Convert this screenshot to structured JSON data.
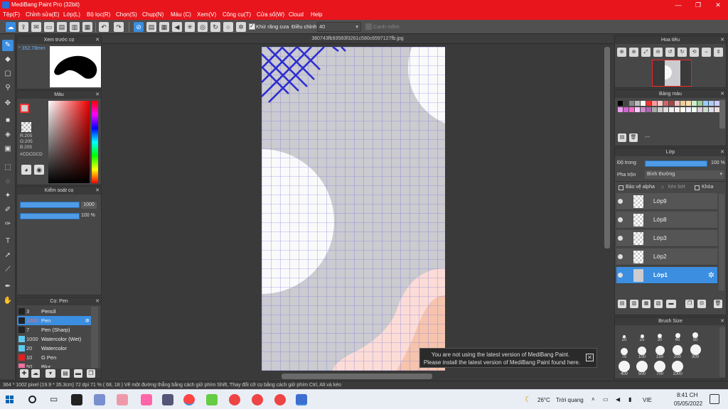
{
  "window": {
    "title": "MediBang Paint Pro (32bit)"
  },
  "menu": [
    "Tệp(F)",
    "Chỉnh sửa(E)",
    "Lớp(L)",
    "Bộ lọc(R)",
    "Chọn(S)",
    "Chụp(N)",
    "Màu (C)",
    "Xem(V)",
    "Công cụ(T)",
    "Cửa sổ(W)",
    "Cloud",
    "Help"
  ],
  "toolbar": {
    "antialias_label": "Khử răng cưa",
    "adjust_label": "Điều chỉnh",
    "adjust_value": "40",
    "edge_label": "Cạnh mềm"
  },
  "preview_panel": {
    "title": "Xem trước cọ",
    "size_text": "352.78mm"
  },
  "color_panel": {
    "title": "Màu",
    "r": "R:205",
    "g": "G:205",
    "b": "B:205",
    "hex": "#CDCDCD"
  },
  "brush_control": {
    "title": "Kiểm soát cọ",
    "size_value": "1000",
    "opacity_value": "100 %",
    "size_fraction": 1.0,
    "opacity_fraction": 1.0
  },
  "brush_panel": {
    "title": "Cọ: Pen",
    "items": [
      {
        "size": "3",
        "name": "Pencil",
        "color": "#222222"
      },
      {
        "size": "1000",
        "name": "Pen",
        "color": "#222222"
      },
      {
        "size": "7",
        "name": "Pen (Sharp)",
        "color": "#222222"
      },
      {
        "size": "1000",
        "name": "Watercolor (Wet)",
        "color": "#5fc8f0"
      },
      {
        "size": "20",
        "name": "Watercolor",
        "color": "#5fc8f0"
      },
      {
        "size": "10",
        "name": "G Pen",
        "color": "#e02020"
      },
      {
        "size": "50",
        "name": "Blur",
        "color": "#f06fa0"
      }
    ]
  },
  "document": {
    "tab_title": "380743fb93583f3261c580c6597127fb.jpg"
  },
  "notice": {
    "line1": "You are not using the latest version of MediBang Paint.",
    "line2": "Please install the latest version of MediBang Paint found here."
  },
  "navigator": {
    "title": "Hoa tiêu"
  },
  "palette": {
    "title": "Bảng màu",
    "label": "---"
  },
  "layer_panel": {
    "title": "Lớp",
    "opacity_label": "Độ trong",
    "opacity_value": "100 %",
    "opacity_fraction": 1.0,
    "blend_label": "Pha trộn",
    "blend_value": "Bình thường",
    "protect_alpha": "Bảo vệ alpha",
    "clipping": "Xén bớt",
    "lock": "Khóa",
    "layers": [
      {
        "name": "Lớp9",
        "selected": false
      },
      {
        "name": "Lớp8",
        "selected": false
      },
      {
        "name": "Lớp3",
        "selected": false
      },
      {
        "name": "Lớp2",
        "selected": false
      },
      {
        "name": "Lớp1",
        "selected": true
      }
    ]
  },
  "brush_size_panel": {
    "title": "Brush Size",
    "sizes": [
      "20",
      "25",
      "30",
      "40",
      "50",
      "70",
      "100",
      "150",
      "200",
      "300",
      "400",
      "500",
      "700",
      "1000"
    ]
  },
  "status": {
    "text": "364 * 1002 pixel   (19.9 * 35.3cm)   72 dpi   71 %   ( 68, 18 )   Vẽ một đường thẳng bằng cách giữ phím Shift, Thay đổi cỡ cọ bằng cách giữ phím Ctrl, Alt và kéo"
  },
  "taskbar": {
    "weather_temp": "26°C",
    "weather_text": "Trời quang",
    "lang": "VIE",
    "time": "8:41 CH",
    "date": "05/05/2022"
  }
}
